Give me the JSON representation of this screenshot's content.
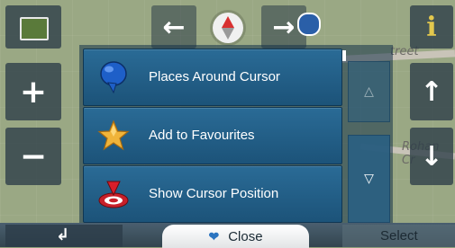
{
  "map": {
    "street_label_1": "treet",
    "street_label_2": "Rohan Cr"
  },
  "menu": {
    "items": [
      {
        "label": "Places Around Cursor",
        "icon": "blue-pin-icon"
      },
      {
        "label": "Add to Favourites",
        "icon": "star-icon"
      },
      {
        "label": "Show Cursor Position",
        "icon": "target-marker-icon"
      }
    ]
  },
  "bottom_bar": {
    "close_label": "Close",
    "select_label": "Select"
  },
  "colors": {
    "menu_blue": "#2a6b96",
    "tile_dark": "#2c3c48",
    "close_bg": "#ffffff"
  }
}
